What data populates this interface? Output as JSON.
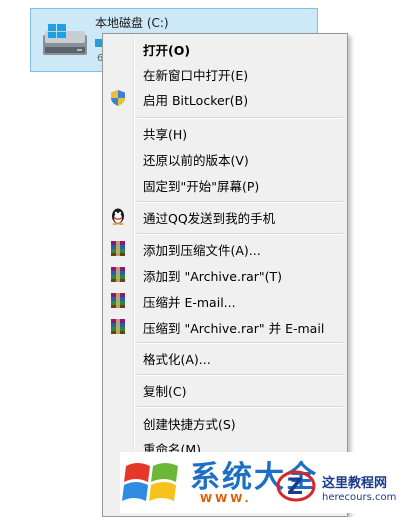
{
  "drive": {
    "name": "本地磁盘 (C:)",
    "icon": "hard-drive-icon"
  },
  "menu": {
    "items": [
      {
        "label": "打开(O)",
        "bold": true
      },
      {
        "label": "在新窗口中打开(E)"
      },
      {
        "label": "启用 BitLocker(B)",
        "icon": "uac-shield-icon"
      },
      {
        "label": "共享(H)"
      },
      {
        "label": "还原以前的版本(V)"
      },
      {
        "label": "固定到\"开始\"屏幕(P)"
      },
      {
        "label": "通过QQ发送到我的手机",
        "icon": "qq-penguin-icon"
      },
      {
        "label": "添加到压缩文件(A)...",
        "icon": "winrar-icon"
      },
      {
        "label": "添加到 \"Archive.rar\"(T)",
        "icon": "winrar-icon"
      },
      {
        "label": "压缩并 E-mail...",
        "icon": "winrar-icon"
      },
      {
        "label": "压缩到 \"Archive.rar\" 并 E-mail",
        "icon": "winrar-icon"
      },
      {
        "label": "格式化(A)..."
      },
      {
        "label": "复制(C)"
      },
      {
        "label": "创建快捷方式(S)"
      },
      {
        "label": "重命名(M)"
      }
    ]
  },
  "watermark": {
    "title": "系统大全",
    "url": "WWW.",
    "site_name": "这里教程网",
    "site_url": "herecours.com"
  },
  "colors": {
    "selection_bg": "#cde8f7",
    "selection_border": "#7fc1e6",
    "menu_bg": "#f0f0f0"
  }
}
